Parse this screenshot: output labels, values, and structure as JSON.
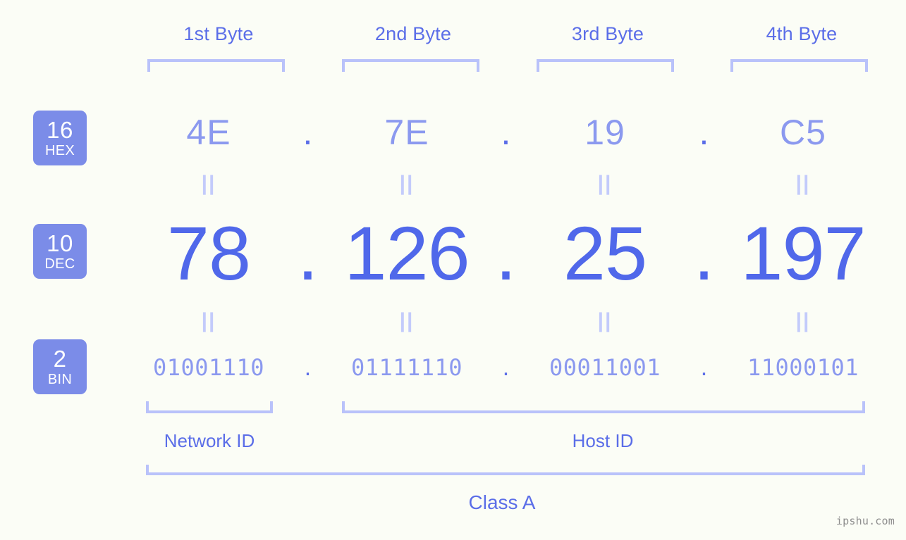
{
  "meta": {
    "watermark": "ipshu.com",
    "accent_strong": "#5068ea",
    "accent_mid": "#5b6ee8",
    "accent_light": "#8b99ef",
    "accent_pale": "#b9c2fa",
    "badge_bg": "#7b8ce8",
    "background": "#fbfdf6"
  },
  "byte_headers": [
    {
      "label": "1st Byte"
    },
    {
      "label": "2nd Byte"
    },
    {
      "label": "3rd Byte"
    },
    {
      "label": "4th Byte"
    }
  ],
  "radix_badges": [
    {
      "number": "16",
      "unit": "HEX"
    },
    {
      "number": "10",
      "unit": "DEC"
    },
    {
      "number": "2",
      "unit": "BIN"
    }
  ],
  "separator": ".",
  "equality_mark": "||",
  "rows": {
    "hex": {
      "radix_number": "16",
      "radix_unit": "HEX",
      "values": [
        "4E",
        "7E",
        "19",
        "C5"
      ]
    },
    "dec": {
      "radix_number": "10",
      "radix_unit": "DEC",
      "values": [
        "78",
        "126",
        "25",
        "197"
      ]
    },
    "bin": {
      "radix_number": "2",
      "radix_unit": "BIN",
      "values": [
        "01001110",
        "01111110",
        "00011001",
        "11000101"
      ]
    }
  },
  "sections": {
    "network_id": {
      "label": "Network ID"
    },
    "host_id": {
      "label": "Host ID"
    },
    "class": {
      "label": "Class A"
    }
  }
}
